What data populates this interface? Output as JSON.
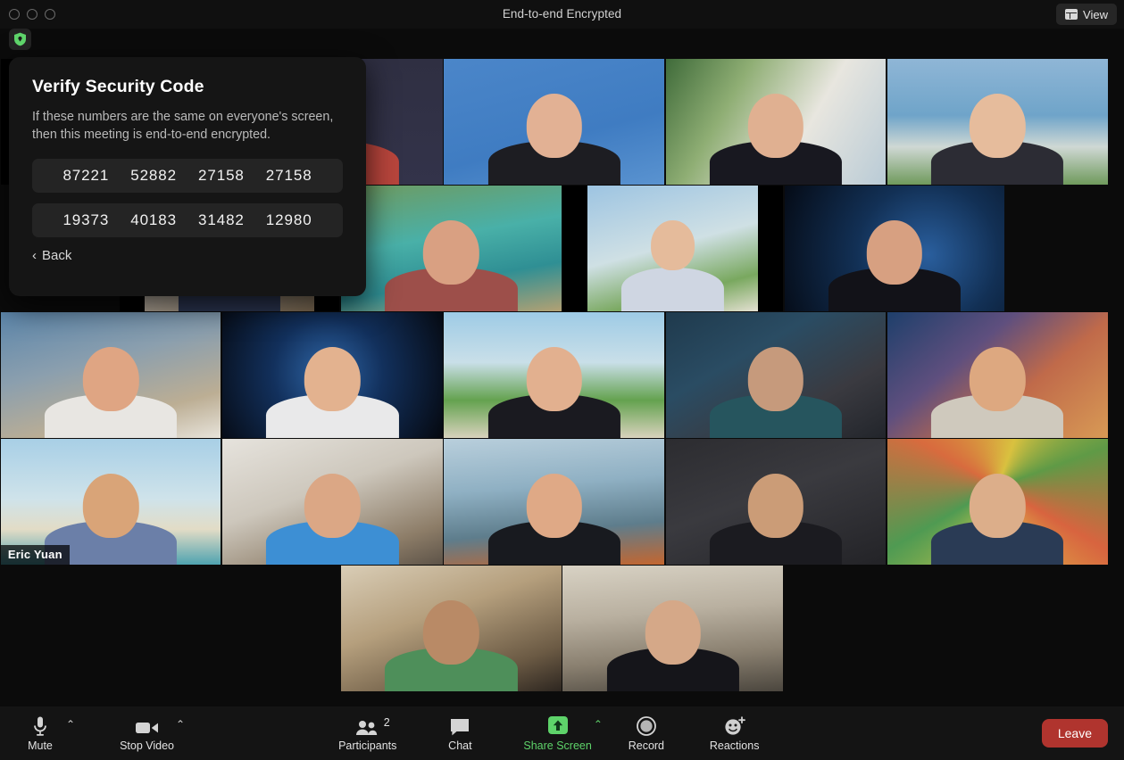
{
  "window": {
    "title": "End-to-end Encrypted",
    "traffic_lights": [
      "close",
      "minimize",
      "zoom"
    ],
    "view_button": {
      "label": "View",
      "icon": "grid-view-icon"
    },
    "security_shield_icon": "shield-lock-icon",
    "shield_color": "#5ed36a"
  },
  "popup": {
    "title": "Verify Security Code",
    "description": "If these numbers are the same on everyone's screen, then this meeting is end-to-end encrypted.",
    "code_rows": [
      [
        "87221",
        "52882",
        "27158",
        "27158"
      ],
      [
        "19373",
        "40183",
        "31482",
        "12980"
      ]
    ],
    "back": {
      "label": "Back",
      "chevron": "‹"
    }
  },
  "grid": {
    "active_border_color": "#e3eb9a",
    "rows": [
      {
        "tiles": [
          {
            "name": "participant-tile",
            "bg": "linear-gradient(160deg,#3a3a4e 0%,#2b2b3c 55%,#45343a 100%)",
            "fit": "narrow",
            "head": "#d9a98a",
            "body": "#c0453a"
          },
          {
            "name": "participant-tile",
            "bg": "linear-gradient(180deg,#2f2f42 0%,#33334a 100%)",
            "fit": "full",
            "head": "#d9a98a",
            "body": "#b8453c"
          },
          {
            "name": "participant-tile",
            "bg": "linear-gradient(165deg,#4b86c9 0%,#3f7cc2 60%,#5a93d0 100%)",
            "fit": "full",
            "head": "#e2b194",
            "body": "#1d1d22"
          },
          {
            "name": "participant-tile",
            "bg": "linear-gradient(120deg,#3f6b3a 0%,#8fae74 30%,#e8e6df 62%,#b9cbd6 100%)",
            "fit": "full",
            "head": "#e0b091",
            "body": "#181820"
          },
          {
            "name": "participant-tile",
            "bg": "linear-gradient(180deg,#8fb6d6 0%,#6fa4c9 45%,#cfd8d4 70%,#6f9a5c 100%)",
            "fit": "full",
            "head": "#e6bc9c",
            "body": "#2c2c34"
          }
        ]
      },
      {
        "tiles": [
          {
            "name": "participant-tile",
            "bg": "linear-gradient(160deg,#e8e6e1 0%,#cfc9c0 45%,#7d6a52 100%)",
            "fit": "narrow",
            "head": "#d9a98a",
            "body": "#2b3550"
          },
          {
            "name": "participant-tile",
            "bg": "linear-gradient(170deg,#6f9a5f 0%,#49b0a8 42%,#2f8f94 70%,#b3a173 100%)",
            "fit": "full",
            "head": "#d9a082",
            "body": "#9d4f4a"
          },
          {
            "name": "participant-tile",
            "bg": "linear-gradient(165deg,#9dc4e2 0%,#cfe0e4 48%,#79a85f 78%,#e4e0d2 100%)",
            "fit": "narrow",
            "head": "#e5bb9b",
            "body": "#cfd6e2"
          },
          {
            "name": "participant-tile",
            "bg": "radial-gradient(circle at 65% 55%,#2a5f9e 0%,#123055 45%,#050b16 100%)",
            "fit": "full",
            "head": "#d7a081",
            "body": "#121218"
          }
        ]
      },
      {
        "tiles": [
          {
            "name": "participant-tile",
            "bg": "linear-gradient(165deg,#5c86ab 0%,#8b9fae 40%,#bcae94 75%,#e7e3da 100%)",
            "fit": "full",
            "head": "#dfa583",
            "body": "#e8e6e2"
          },
          {
            "name": "participant-tile",
            "bg": "radial-gradient(circle at 48% 48%,#2f66a6 0%,#12305c 42%,#05080f 100%)",
            "fit": "full",
            "head": "#e3b28f",
            "body": "#e9e9ea"
          },
          {
            "name": "participant-tile",
            "bg": "linear-gradient(180deg,#9ecbe6 0%,#c9dfe8 40%,#64a24f 70%,#d8d2bd 100%)",
            "fit": "full",
            "head": "#e2b08f",
            "body": "#1a1a20"
          },
          {
            "name": "participant-tile",
            "bg": "linear-gradient(150deg,#1f3a4d 0%,#2a4c63 35%,#3a3a40 70%,#22252b 100%)",
            "fit": "full",
            "head": "#c69a7c",
            "body": "#26555e"
          },
          {
            "name": "participant-tile",
            "bg": "linear-gradient(140deg,#1e3f6b 0%,#5f4f7e 35%,#c06a4a 62%,#d89a55 100%)",
            "fit": "full",
            "head": "#dda880",
            "body": "#cfc9bd"
          }
        ]
      },
      {
        "tiles": [
          {
            "name": "participant-tile-eric-yuan",
            "bg": "linear-gradient(180deg,#a8cfe6 0%,#cfe3ea 48%,#e2dcc6 72%,#4fa3b0 100%)",
            "fit": "full",
            "head": "#d9a478",
            "body": "#6b7fa8",
            "label": "Eric Yuan",
            "active": true
          },
          {
            "name": "participant-tile",
            "bg": "linear-gradient(160deg,#e6e3dd 0%,#cdc7bc 42%,#8d7d68 80%,#5d5348 100%)",
            "fit": "full",
            "head": "#dba785",
            "body": "#3d8fd4"
          },
          {
            "name": "participant-tile",
            "bg": "linear-gradient(175deg,#b9cfdc 0%,#8fb0c3 38%,#5e7d8c 70%,#c4662f 100%)",
            "fit": "full",
            "head": "#dfa986",
            "body": "#181a1f"
          },
          {
            "name": "participant-tile",
            "bg": "linear-gradient(160deg,#2c2c30 0%,#3a3a3f 45%,#232327 100%)",
            "fit": "full",
            "head": "#cb9c77",
            "body": "#1b1b20"
          },
          {
            "name": "participant-tile",
            "bg": "conic-gradient(from 20deg at 50% 38%,#d9c13f 0deg,#5f9a46 50deg,#d8643f 100deg,#e0cf4a 160deg,#4f9a52 220deg,#d86b3e 280deg,#d9c13f 360deg)",
            "fit": "full",
            "head": "#dcae8a",
            "body": "#2a3b55"
          }
        ]
      },
      {
        "tiles": [
          {
            "name": "participant-tile",
            "bg": "linear-gradient(160deg,#d9cdb6 0%,#b59f7d 40%,#6b5a44 78%,#2d2620 100%)",
            "fit": "full",
            "head": "#b98a66",
            "body": "#4e8f5a"
          },
          {
            "name": "participant-tile",
            "bg": "linear-gradient(175deg,#d8d2c4 0%,#b9b0a0 38%,#8a8070 70%,#4b463e 100%)",
            "fit": "full",
            "head": "#d5a888",
            "body": "#15151a"
          }
        ]
      }
    ]
  },
  "toolbar": {
    "items": [
      {
        "name": "mute-button",
        "label": "Mute",
        "icon": "microphone-icon",
        "chevron": true,
        "accent": false
      },
      {
        "name": "stop-video-button",
        "label": "Stop Video",
        "icon": "video-camera-icon",
        "chevron": true,
        "accent": false
      },
      {
        "name": "participants-button",
        "label": "Participants",
        "icon": "people-icon",
        "chevron": false,
        "accent": false,
        "count": "2"
      },
      {
        "name": "chat-button",
        "label": "Chat",
        "icon": "chat-bubble-icon",
        "chevron": false,
        "accent": false
      },
      {
        "name": "share-screen-button",
        "label": "Share Screen",
        "icon": "share-up-arrow-icon",
        "chevron": true,
        "accent": true
      },
      {
        "name": "record-button",
        "label": "Record",
        "icon": "record-circle-icon",
        "chevron": false,
        "accent": false
      },
      {
        "name": "reactions-button",
        "label": "Reactions",
        "icon": "smiley-plus-icon",
        "chevron": false,
        "accent": false
      }
    ],
    "leave_label": "Leave",
    "leave_color": "#b0342e",
    "accent_color": "#5ed36a"
  }
}
